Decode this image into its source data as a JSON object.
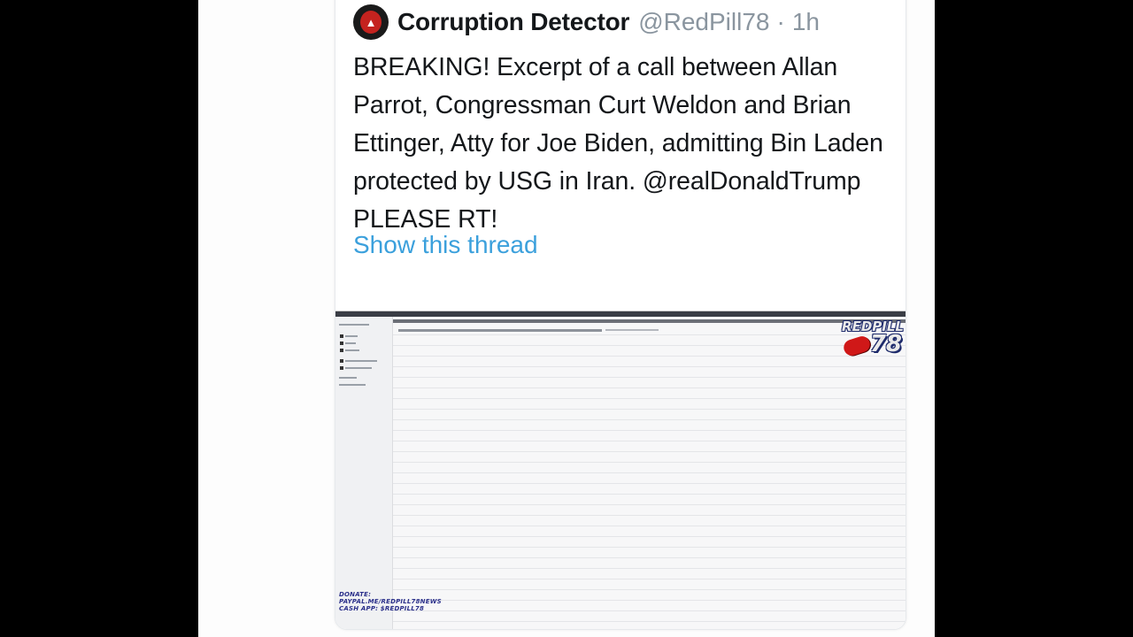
{
  "tweet": {
    "display_name": "Corruption Detector",
    "handle": "@RedPill78",
    "separator": "·",
    "time": "1h",
    "text": "BREAKING! Excerpt of a call between Allan Parrot, Congressman Curt Weldon and Brian Ettinger, Atty for Joe Biden, admitting Bin Laden protected by USG in Iran. @realDonaldTrump PLEASE RT!",
    "show_thread": "Show this thread"
  },
  "media": {
    "watermark_text": "REDPILL",
    "watermark_number": "78",
    "donate_lines": [
      "DONATE:",
      "PAYPAL.ME/REDPILL78NEWS",
      "CASH APP: $REDPILL78"
    ]
  },
  "colors": {
    "link": "#3ba0dc",
    "text": "#14171a",
    "muted": "#8a959f",
    "avatar_accent": "#c4231f"
  }
}
